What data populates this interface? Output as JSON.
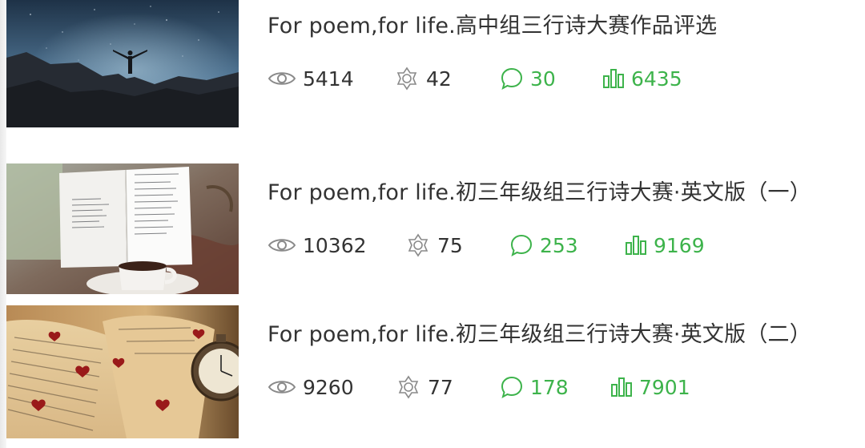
{
  "articles": [
    {
      "title": "For poem,for life.高中组三行诗大赛作品评选",
      "thumbnail": "person-on-mountain-night-sky",
      "views": "5414",
      "likes": "42",
      "comments": "30",
      "shares": "6435"
    },
    {
      "title": "For poem,for life.初三年级组三行诗大赛·英文版（一）",
      "thumbnail": "open-notebook-with-coffee",
      "views": "10362",
      "likes": "75",
      "comments": "253",
      "shares": "9169"
    },
    {
      "title": "For poem,for life.初三年级组三行诗大赛·英文版（二）",
      "thumbnail": "open-book-with-pocket-watch-and-hearts",
      "views": "9260",
      "likes": "77",
      "comments": "178",
      "shares": "7901"
    }
  ],
  "colors": {
    "text": "#333333",
    "accent_green": "#3db34b",
    "icon_gray": "#8a8a8a"
  },
  "icons": {
    "views": "eye-icon",
    "likes": "flower-icon",
    "comments": "comment-bubble-icon",
    "shares": "bar-chart-icon"
  }
}
